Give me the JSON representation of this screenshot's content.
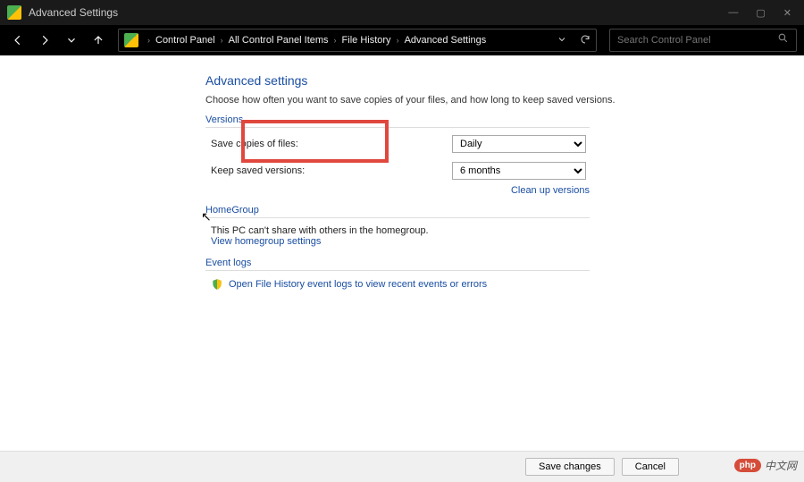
{
  "window": {
    "title": "Advanced Settings",
    "minimize": "—",
    "maximize": "▢",
    "close": "✕"
  },
  "breadcrumb": {
    "items": [
      "Control Panel",
      "All Control Panel Items",
      "File History",
      "Advanced Settings"
    ]
  },
  "search": {
    "placeholder": "Search Control Panel"
  },
  "page": {
    "title": "Advanced settings",
    "desc": "Choose how often you want to save copies of your files, and how long to keep saved versions."
  },
  "versions": {
    "header": "Versions",
    "save_label": "Save copies of files:",
    "save_value": "Daily",
    "keep_label": "Keep saved versions:",
    "keep_value": "6 months",
    "cleanup": "Clean up versions"
  },
  "homegroup": {
    "header": "HomeGroup",
    "text": "This PC can't share with others in the homegroup.",
    "link": "View homegroup settings"
  },
  "eventlogs": {
    "header": "Event logs",
    "link": "Open File History event logs to view recent events or errors"
  },
  "footer": {
    "save": "Save changes",
    "cancel": "Cancel"
  },
  "watermark": {
    "logo": "php",
    "text": "中文网"
  }
}
